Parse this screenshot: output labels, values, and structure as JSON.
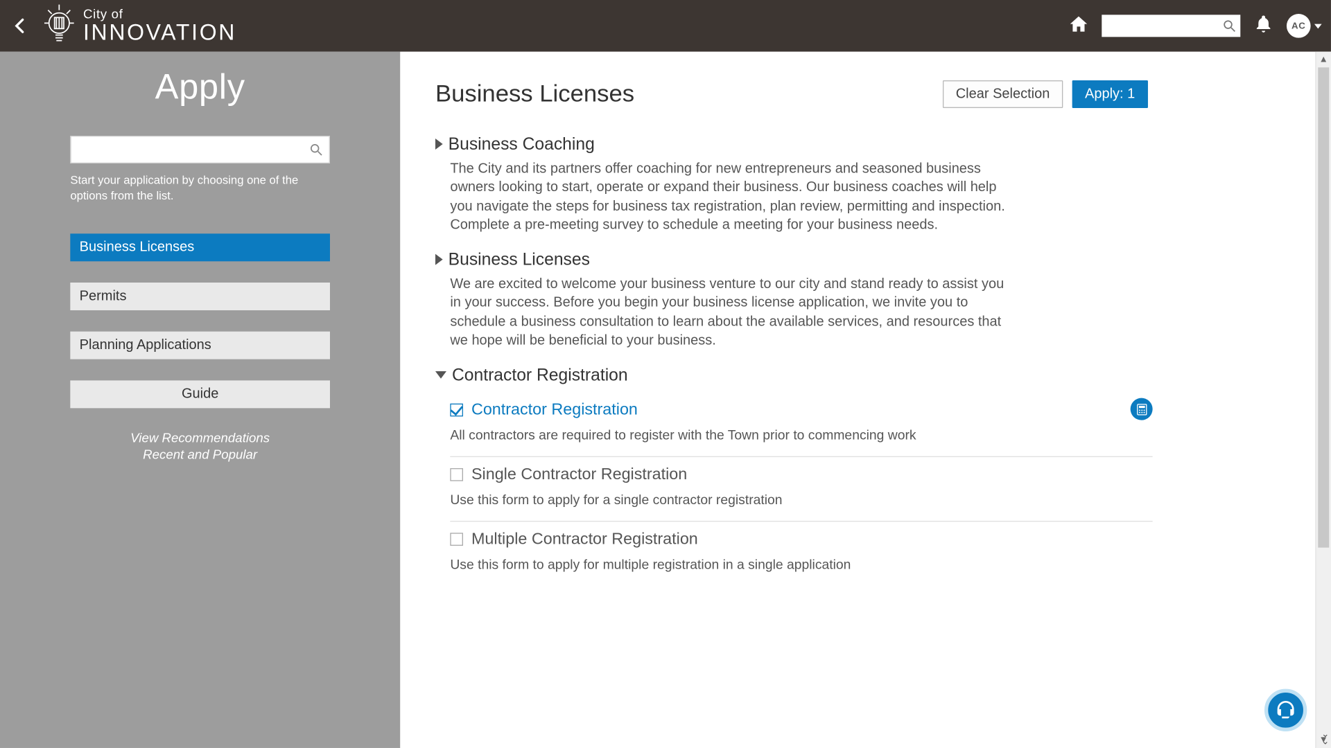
{
  "colors": {
    "accent": "#0c7bc0",
    "topbar": "#3d3632",
    "sidebar": "#9d9d9d"
  },
  "header": {
    "logo_top": "City of",
    "logo_bottom": "INNOVATION",
    "search_value": "",
    "avatar_initials": "AC"
  },
  "sidebar": {
    "title": "Apply",
    "search_value": "",
    "help_text": "Start your application by choosing one of the options from the list.",
    "buttons": [
      {
        "label": "Business Licenses",
        "active": true
      },
      {
        "label": "Permits",
        "active": false
      },
      {
        "label": "Planning Applications",
        "active": false
      },
      {
        "label": "Guide",
        "active": false,
        "center": true
      }
    ],
    "link": "View Recommendations\nRecent and Popular"
  },
  "main": {
    "title": "Business Licenses",
    "clear_label": "Clear Selection",
    "apply_label": "Apply: 1",
    "sections": [
      {
        "expanded": false,
        "title": "Business Coaching",
        "description": "The City and its partners offer coaching for new entrepreneurs and seasoned business owners looking to start, operate or expand their business. Our business coaches will help you navigate the steps for business tax registration, plan review, permitting and inspection. Complete a pre-meeting survey to schedule a meeting for your business needs."
      },
      {
        "expanded": false,
        "title": "Business Licenses",
        "description": "We are excited to welcome your business venture to our city and stand ready to assist you in your success. Before you begin your business license application, we invite you to schedule a business consultation to learn about the available services, and resources that we hope will be beneficial to your business."
      },
      {
        "expanded": true,
        "title": "Contractor Registration",
        "items": [
          {
            "checked": true,
            "title": "Contractor Registration",
            "desc": "All contractors are required to register with the Town prior to commencing work",
            "has_fee_icon": true
          },
          {
            "checked": false,
            "title": "Single Contractor Registration",
            "desc": "Use this form to apply for a single contractor registration"
          },
          {
            "checked": false,
            "title": "Multiple Contractor Registration",
            "desc": "Use this form to apply for multiple registration in a single application"
          }
        ]
      }
    ]
  }
}
